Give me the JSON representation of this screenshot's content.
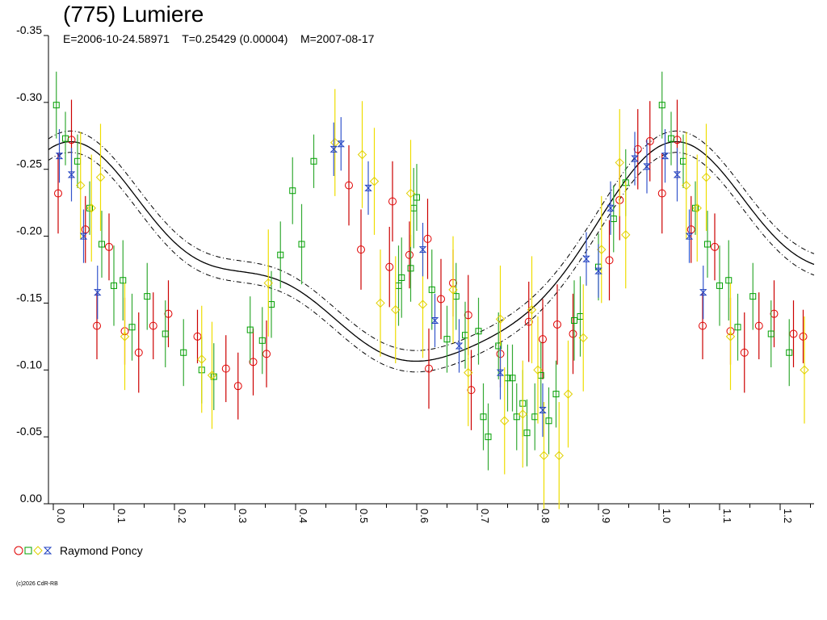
{
  "chart_data": {
    "type": "scatter",
    "title": "(775) Lumiere",
    "subtitle": "E=2006-10-24.58971    T=0.25429 (0.00004)    M=2007-08-17",
    "x_range": [
      0.0,
      1.25
    ],
    "y_range": [
      -0.35,
      0.0
    ],
    "y_inverted": true,
    "x_ticks": [
      "0.0",
      "0.1",
      "0.2",
      "0.3",
      "0.4",
      "0.5",
      "0.6",
      "0.7",
      "0.8",
      "0.9",
      "1.0",
      "1.1",
      "1.2"
    ],
    "y_ticks": [
      "-0.35",
      "-0.30",
      "-0.25",
      "-0.20",
      "-0.15",
      "-0.10",
      "-0.05",
      "0.00"
    ],
    "grid": false,
    "legend": {
      "position": "bottom-left",
      "label": "Raymond Poncy"
    },
    "series": [
      {
        "marker": "circle",
        "color": "#e00000",
        "errcolor": "#cc0000",
        "points": [
          [
            0.008,
            -0.232,
            0.03
          ],
          [
            0.03,
            -0.272,
            0.03
          ],
          [
            0.053,
            -0.205,
            0.025
          ],
          [
            0.072,
            -0.133,
            0.025
          ],
          [
            0.092,
            -0.192,
            0.025
          ],
          [
            0.118,
            -0.129,
            0.025
          ],
          [
            0.141,
            -0.113,
            0.03
          ],
          [
            0.165,
            -0.133,
            0.025
          ],
          [
            0.19,
            -0.142,
            0.025
          ],
          [
            0.238,
            -0.125,
            0.02
          ],
          [
            0.285,
            -0.101,
            0.025
          ],
          [
            0.305,
            -0.088,
            0.025
          ],
          [
            0.33,
            -0.106,
            0.025
          ],
          [
            0.352,
            -0.112,
            0.025
          ],
          [
            0.488,
            -0.238,
            0.03
          ],
          [
            0.508,
            -0.19,
            0.03
          ],
          [
            0.555,
            -0.177,
            0.03
          ],
          [
            0.56,
            -0.226,
            0.03
          ],
          [
            0.588,
            -0.186,
            0.025
          ],
          [
            0.62,
            -0.101,
            0.03
          ],
          [
            0.618,
            -0.198,
            0.03
          ],
          [
            0.64,
            -0.153,
            0.03
          ],
          [
            0.66,
            -0.165,
            0.025
          ],
          [
            0.685,
            -0.141,
            0.03
          ],
          [
            0.69,
            -0.085,
            0.03
          ],
          [
            0.738,
            -0.112,
            0.025
          ],
          [
            0.785,
            -0.136,
            0.03
          ],
          [
            0.808,
            -0.123,
            0.03
          ],
          [
            0.832,
            -0.134,
            0.03
          ],
          [
            0.858,
            -0.127,
            0.03
          ],
          [
            0.918,
            -0.182,
            0.03
          ],
          [
            0.935,
            -0.227,
            0.03
          ],
          [
            0.965,
            -0.265,
            0.03
          ],
          [
            0.985,
            -0.271,
            0.03
          ],
          [
            1.005,
            -0.232,
            0.03
          ],
          [
            1.03,
            -0.272,
            0.03
          ],
          [
            1.053,
            -0.205,
            0.025
          ],
          [
            1.072,
            -0.133,
            0.025
          ],
          [
            1.092,
            -0.192,
            0.025
          ],
          [
            1.118,
            -0.129,
            0.025
          ],
          [
            1.141,
            -0.113,
            0.03
          ],
          [
            1.165,
            -0.133,
            0.025
          ],
          [
            1.19,
            -0.142,
            0.025
          ],
          [
            1.222,
            -0.127,
            0.025
          ],
          [
            1.238,
            -0.125,
            0.02
          ]
        ]
      },
      {
        "marker": "square",
        "color": "#00a000",
        "errcolor": "#33aa33",
        "points": [
          [
            0.005,
            -0.298,
            0.025
          ],
          [
            0.02,
            -0.273,
            0.02
          ],
          [
            0.04,
            -0.256,
            0.02
          ],
          [
            0.06,
            -0.221,
            0.02
          ],
          [
            0.08,
            -0.194,
            0.025
          ],
          [
            0.1,
            -0.163,
            0.03
          ],
          [
            0.115,
            -0.167,
            0.03
          ],
          [
            0.13,
            -0.132,
            0.025
          ],
          [
            0.155,
            -0.155,
            0.025
          ],
          [
            0.185,
            -0.127,
            0.025
          ],
          [
            0.215,
            -0.113,
            0.025
          ],
          [
            0.245,
            -0.1,
            0.025
          ],
          [
            0.265,
            -0.095,
            0.025
          ],
          [
            0.325,
            -0.13,
            0.025
          ],
          [
            0.345,
            -0.122,
            0.025
          ],
          [
            0.36,
            -0.149,
            0.025
          ],
          [
            0.375,
            -0.186,
            0.025
          ],
          [
            0.395,
            -0.234,
            0.025
          ],
          [
            0.41,
            -0.194,
            0.03
          ],
          [
            0.43,
            -0.256,
            0.02
          ],
          [
            0.57,
            -0.163,
            0.03
          ],
          [
            0.575,
            -0.169,
            0.03
          ],
          [
            0.59,
            -0.176,
            0.025
          ],
          [
            0.595,
            -0.221,
            0.03
          ],
          [
            0.6,
            -0.229,
            0.025
          ],
          [
            0.625,
            -0.16,
            0.03
          ],
          [
            0.65,
            -0.123,
            0.025
          ],
          [
            0.665,
            -0.155,
            0.025
          ],
          [
            0.68,
            -0.126,
            0.025
          ],
          [
            0.702,
            -0.129,
            0.025
          ],
          [
            0.71,
            -0.065,
            0.025
          ],
          [
            0.718,
            -0.05,
            0.025
          ],
          [
            0.735,
            -0.118,
            0.025
          ],
          [
            0.75,
            -0.094,
            0.025
          ],
          [
            0.758,
            -0.094,
            0.025
          ],
          [
            0.765,
            -0.065,
            0.025
          ],
          [
            0.775,
            -0.075,
            0.025
          ],
          [
            0.782,
            -0.053,
            0.025
          ],
          [
            0.795,
            -0.065,
            0.025
          ],
          [
            0.805,
            -0.096,
            0.025
          ],
          [
            0.818,
            -0.062,
            0.025
          ],
          [
            0.83,
            -0.082,
            0.025
          ],
          [
            0.86,
            -0.137,
            0.03
          ],
          [
            0.87,
            -0.14,
            0.03
          ],
          [
            0.9,
            -0.177,
            0.025
          ],
          [
            0.925,
            -0.213,
            0.025
          ],
          [
            0.945,
            -0.24,
            0.025
          ],
          [
            1.005,
            -0.298,
            0.025
          ],
          [
            1.02,
            -0.273,
            0.02
          ],
          [
            1.04,
            -0.256,
            0.02
          ],
          [
            1.06,
            -0.221,
            0.02
          ],
          [
            1.08,
            -0.194,
            0.025
          ],
          [
            1.1,
            -0.163,
            0.03
          ],
          [
            1.115,
            -0.167,
            0.03
          ],
          [
            1.13,
            -0.132,
            0.025
          ],
          [
            1.155,
            -0.155,
            0.025
          ],
          [
            1.185,
            -0.127,
            0.025
          ],
          [
            1.215,
            -0.113,
            0.025
          ]
        ]
      },
      {
        "marker": "diamond",
        "color": "#e0d000",
        "errcolor": "#eedd00",
        "points": [
          [
            0.045,
            -0.238,
            0.04
          ],
          [
            0.063,
            -0.221,
            0.04
          ],
          [
            0.078,
            -0.244,
            0.04
          ],
          [
            0.118,
            -0.125,
            0.04
          ],
          [
            0.245,
            -0.108,
            0.04
          ],
          [
            0.262,
            -0.096,
            0.04
          ],
          [
            0.355,
            -0.165,
            0.04
          ],
          [
            0.465,
            -0.27,
            0.04
          ],
          [
            0.51,
            -0.261,
            0.04
          ],
          [
            0.53,
            -0.241,
            0.04
          ],
          [
            0.54,
            -0.15,
            0.04
          ],
          [
            0.565,
            -0.145,
            0.04
          ],
          [
            0.59,
            -0.232,
            0.04
          ],
          [
            0.61,
            -0.149,
            0.04
          ],
          [
            0.66,
            -0.16,
            0.04
          ],
          [
            0.685,
            -0.098,
            0.04
          ],
          [
            0.738,
            -0.138,
            0.04
          ],
          [
            0.745,
            -0.062,
            0.04
          ],
          [
            0.775,
            -0.067,
            0.04
          ],
          [
            0.79,
            -0.145,
            0.04
          ],
          [
            0.8,
            -0.1,
            0.04
          ],
          [
            0.81,
            -0.036,
            0.04
          ],
          [
            0.835,
            -0.036,
            0.04
          ],
          [
            0.85,
            -0.082,
            0.04
          ],
          [
            0.875,
            -0.124,
            0.04
          ],
          [
            0.905,
            -0.19,
            0.04
          ],
          [
            0.935,
            -0.255,
            0.04
          ],
          [
            0.945,
            -0.201,
            0.04
          ],
          [
            1.045,
            -0.238,
            0.04
          ],
          [
            1.063,
            -0.221,
            0.04
          ],
          [
            1.078,
            -0.244,
            0.04
          ],
          [
            1.118,
            -0.125,
            0.04
          ],
          [
            1.24,
            -0.1,
            0.04
          ]
        ]
      },
      {
        "marker": "hourglass",
        "color": "#2040c0",
        "errcolor": "#3355cc",
        "points": [
          [
            0.01,
            -0.26,
            0.02
          ],
          [
            0.03,
            -0.246,
            0.02
          ],
          [
            0.05,
            -0.2,
            0.02
          ],
          [
            0.073,
            -0.158,
            0.02
          ],
          [
            0.463,
            -0.265,
            0.02
          ],
          [
            0.475,
            -0.269,
            0.02
          ],
          [
            0.52,
            -0.236,
            0.02
          ],
          [
            0.61,
            -0.19,
            0.02
          ],
          [
            0.63,
            -0.137,
            0.02
          ],
          [
            0.67,
            -0.118,
            0.02
          ],
          [
            0.738,
            -0.098,
            0.02
          ],
          [
            0.808,
            -0.07,
            0.02
          ],
          [
            0.88,
            -0.183,
            0.02
          ],
          [
            0.9,
            -0.174,
            0.02
          ],
          [
            0.92,
            -0.221,
            0.02
          ],
          [
            0.96,
            -0.258,
            0.02
          ],
          [
            0.98,
            -0.252,
            0.02
          ],
          [
            1.01,
            -0.26,
            0.02
          ],
          [
            1.03,
            -0.246,
            0.02
          ],
          [
            1.05,
            -0.2,
            0.02
          ],
          [
            1.073,
            -0.158,
            0.02
          ]
        ]
      }
    ],
    "fit_curve": {
      "mean": 0.176,
      "coeffs": [
        [
          0.063,
          0.03
        ],
        [
          0.02,
          -0.004
        ],
        [
          0.008,
          0.006
        ]
      ],
      "envelope": 0.008
    }
  },
  "legend": {
    "label": "Raymond Poncy"
  },
  "footer": {
    "copyright": "(c)2026 CdR-RB"
  },
  "colors": {
    "red": "#e00000",
    "green": "#00a000",
    "yellow": "#e0d000",
    "blue": "#2040c0"
  }
}
